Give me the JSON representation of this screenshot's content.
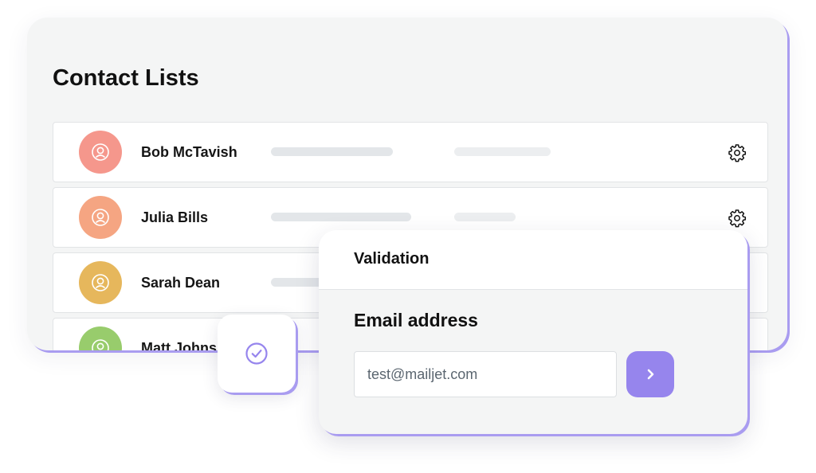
{
  "contact_lists": {
    "title": "Contact Lists",
    "contacts": [
      {
        "name": "Bob McTavish",
        "avatar_color": "#f5978c"
      },
      {
        "name": "Julia Bills",
        "avatar_color": "#f5a582"
      },
      {
        "name": "Sarah Dean",
        "avatar_color": "#e6b75c"
      },
      {
        "name": "Matt Johns",
        "avatar_color": "#98cc6c"
      }
    ],
    "row_icon": "gear-icon",
    "avatar_icon": "user-icon"
  },
  "validation": {
    "title": "Validation",
    "email_label": "Email address",
    "email_value": "test@mailjet.com",
    "submit_icon": "chevron-right-icon"
  },
  "check_tile": {
    "icon": "check-circle-icon"
  },
  "colors": {
    "accent": "#9685ed",
    "accent_shadow": "#a99cf0",
    "card_background": "#f4f5f5",
    "placeholder_bar": "#e3e6e9"
  }
}
